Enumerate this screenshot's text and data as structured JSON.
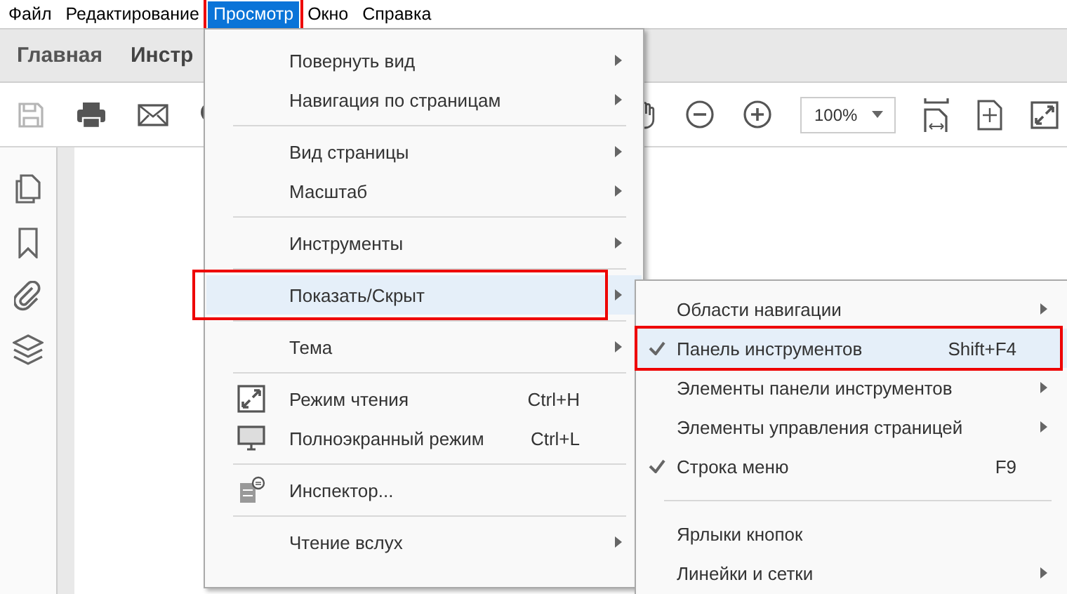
{
  "menu_bar": [
    {
      "label": "Файл",
      "selected": false,
      "annotated": false
    },
    {
      "label": "Редактирование",
      "selected": false,
      "annotated": false
    },
    {
      "label": "Просмотр",
      "selected": true,
      "annotated": true
    },
    {
      "label": "Окно",
      "selected": false,
      "annotated": false
    },
    {
      "label": "Справка",
      "selected": false,
      "annotated": false
    }
  ],
  "tabs": [
    {
      "label": "Главная"
    },
    {
      "label": "Инстр"
    }
  ],
  "toolbar": {
    "zoom_value": "100%"
  },
  "view_menu": [
    {
      "kind": "item",
      "label": "Повернуть вид",
      "submenu": true,
      "selected": false,
      "annotated": false
    },
    {
      "kind": "item",
      "label": "Навигация по страницам",
      "submenu": true,
      "selected": false,
      "annotated": false
    },
    {
      "kind": "separator"
    },
    {
      "kind": "item",
      "label": "Вид страницы",
      "submenu": true,
      "selected": false,
      "annotated": false
    },
    {
      "kind": "item",
      "label": "Масштаб",
      "submenu": true,
      "selected": false,
      "annotated": false
    },
    {
      "kind": "separator"
    },
    {
      "kind": "item",
      "label": "Инструменты",
      "submenu": true,
      "selected": false,
      "annotated": false
    },
    {
      "kind": "separator"
    },
    {
      "kind": "item",
      "label": "Показать/Скрыт",
      "submenu": true,
      "selected": true,
      "annotated": true
    },
    {
      "kind": "separator"
    },
    {
      "kind": "item",
      "label": "Тема",
      "submenu": true,
      "selected": false,
      "annotated": false
    },
    {
      "kind": "separator"
    },
    {
      "kind": "reading",
      "label": "Режим чтения",
      "shortcut": "Ctrl+H",
      "submenu": false,
      "selected": false,
      "annotated": false
    },
    {
      "kind": "fullscreen",
      "label": "Полноэкранный режим",
      "shortcut": "Ctrl+L",
      "submenu": false,
      "selected": false,
      "annotated": false
    },
    {
      "kind": "separator"
    },
    {
      "kind": "inspector",
      "label": "Инспектор...",
      "submenu": false,
      "selected": false,
      "annotated": false
    },
    {
      "kind": "separator"
    },
    {
      "kind": "item",
      "label": "Чтение вслух",
      "submenu": true,
      "selected": false,
      "annotated": false
    }
  ],
  "show_hide_submenu": [
    {
      "kind": "item",
      "label": "Области навигации",
      "submenu": true,
      "checked": false,
      "selected": false,
      "annotated": false
    },
    {
      "kind": "item",
      "label": "Панель инструментов",
      "shortcut": "Shift+F4",
      "submenu": false,
      "checked": true,
      "selected": true,
      "annotated": true
    },
    {
      "kind": "item",
      "label": "Элементы панели инструментов",
      "submenu": true,
      "checked": false,
      "selected": false,
      "annotated": false
    },
    {
      "kind": "item",
      "label": "Элементы управления страницей",
      "submenu": true,
      "checked": false,
      "selected": false,
      "annotated": false
    },
    {
      "kind": "item",
      "label": "Строка меню",
      "shortcut": "F9",
      "submenu": false,
      "checked": true,
      "selected": false,
      "annotated": false
    },
    {
      "kind": "separator"
    },
    {
      "kind": "item",
      "label": "Ярлыки кнопок",
      "submenu": false,
      "checked": false,
      "selected": false,
      "annotated": false
    },
    {
      "kind": "item",
      "label": "Линейки и сетки",
      "submenu": true,
      "checked": false,
      "selected": false,
      "annotated": false
    }
  ]
}
